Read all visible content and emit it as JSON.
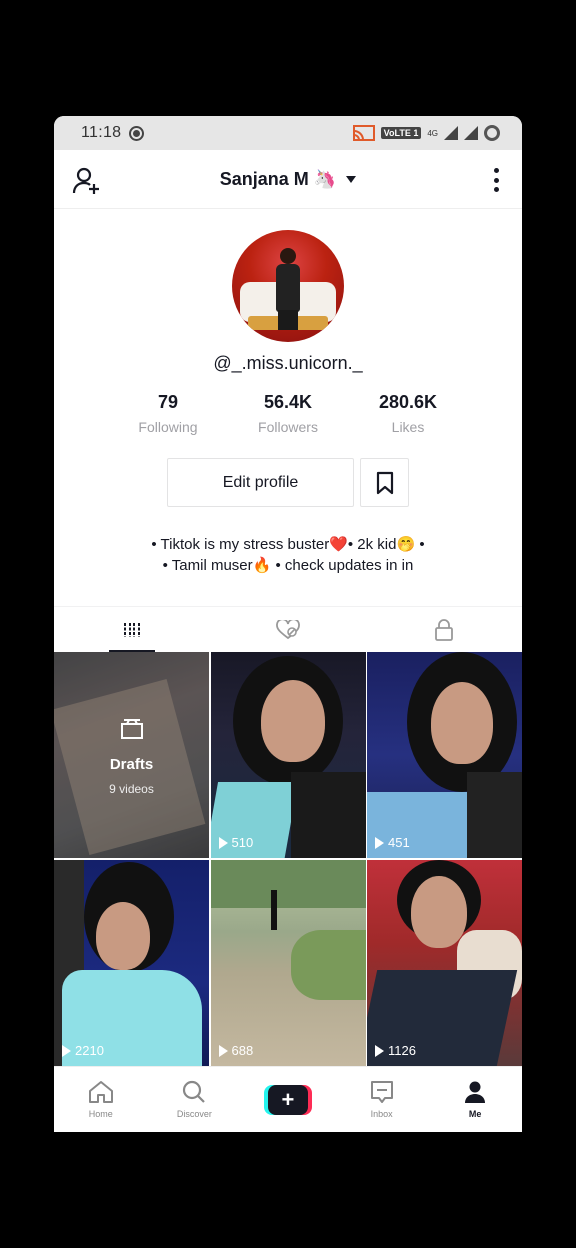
{
  "status_bar": {
    "time": "11:18",
    "volte": "VoLTE 1",
    "net": "4G"
  },
  "header": {
    "username": "Sanjana M 🦄"
  },
  "profile": {
    "handle": "@_.miss.unicorn._",
    "stats": [
      {
        "value": "79",
        "label": "Following"
      },
      {
        "value": "56.4K",
        "label": "Followers"
      },
      {
        "value": "280.6K",
        "label": "Likes"
      }
    ],
    "edit_label": "Edit profile",
    "bio_line1": "• Tiktok is my stress buster❤️•  2k kid🤭 •",
    "bio_line2": "• Tamil muser🔥 • check updates in in"
  },
  "drafts": {
    "label": "Drafts",
    "count": "9 videos"
  },
  "videos": [
    {
      "views": "510"
    },
    {
      "views": "451"
    },
    {
      "views": "2210"
    },
    {
      "views": "688"
    },
    {
      "views": "1126"
    }
  ],
  "nav": {
    "home": "Home",
    "discover": "Discover",
    "create": "+",
    "inbox": "Inbox",
    "me": "Me"
  },
  "colors": {
    "accent_red": "#fe2c55",
    "accent_cyan": "#25f4ee",
    "text": "#161823"
  }
}
